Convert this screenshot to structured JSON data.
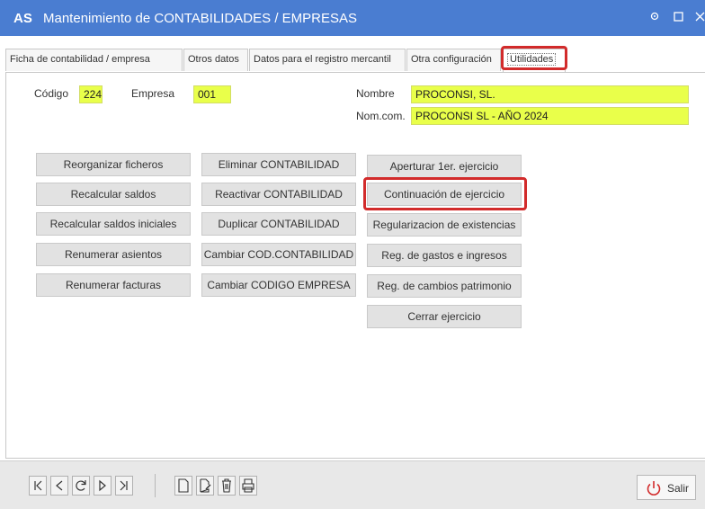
{
  "window": {
    "logo": "AS",
    "title": "Mantenimiento de CONTABILIDADES / EMPRESAS",
    "controls": [
      "pin-icon",
      "maximize-icon",
      "close-icon"
    ]
  },
  "tabs": [
    {
      "label": "Ficha de contabilidad / empresa",
      "active": false
    },
    {
      "label": "Otros datos",
      "active": false
    },
    {
      "label": "Datos para el registro mercantil",
      "active": false
    },
    {
      "label": "Otra configuración",
      "active": false
    },
    {
      "label": "Utilidades",
      "active": true
    }
  ],
  "form": {
    "codigo_label": "Código",
    "codigo_value": "224",
    "empresa_label": "Empresa",
    "empresa_value": "001",
    "nombre_label": "Nombre",
    "nombre_value": "PROCONSI, SL.",
    "nomcom_label": "Nom.com.",
    "nomcom_value": "PROCONSI SL - AÑO 2024"
  },
  "buttons": {
    "col1": [
      "Reorganizar ficheros",
      "Recalcular saldos",
      "Recalcular saldos iniciales",
      "Renumerar asientos",
      "Renumerar facturas"
    ],
    "col2": [
      "Eliminar CONTABILIDAD",
      "Reactivar CONTABILIDAD",
      "Duplicar CONTABILIDAD",
      "Cambiar COD.CONTABILIDAD",
      "Cambiar CODIGO EMPRESA"
    ],
    "col3": [
      "Aperturar 1er. ejercicio",
      "Continuación de ejercicio",
      "Regularizacion de existencias",
      "Reg. de gastos e ingresos",
      "Reg. de cambios patrimonio",
      "Cerrar ejercicio"
    ]
  },
  "highlighted": [
    "Utilidades",
    "Continuación de ejercicio"
  ],
  "toolbar": {
    "nav_icons": [
      "first-record-icon",
      "previous-record-icon",
      "refresh-icon",
      "next-record-icon",
      "last-record-icon"
    ],
    "record_icons": [
      "new-document-icon",
      "edit-document-icon",
      "delete-icon",
      "print-icon"
    ],
    "exit_label": "Salir"
  },
  "colors": {
    "titlebar": "#4a7dd1",
    "field_highlight": "#e9ff4a",
    "annotation": "#d22b2b"
  }
}
